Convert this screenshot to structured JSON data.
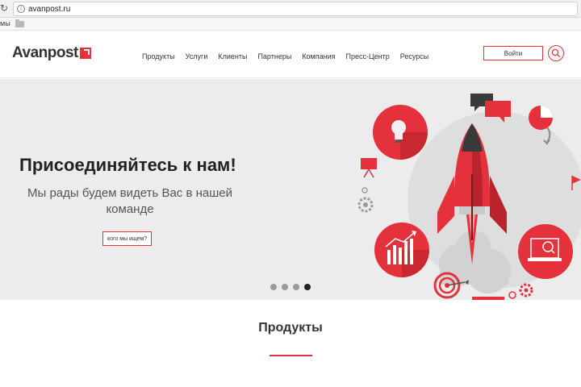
{
  "browser": {
    "url": "avanpost.ru",
    "bookmarks_label": "мы"
  },
  "header": {
    "logo_text": "Avanpost",
    "nav": [
      "Продукты",
      "Услуги",
      "Клиенты",
      "Партнеры",
      "Компания",
      "Пресс-Центр",
      "Ресурсы"
    ],
    "login_label": "Войти"
  },
  "hero": {
    "title": "Присоединяйтесь к нам!",
    "subtitle": "Мы рады будем видеть Вас в нашей команде",
    "cta_label": "кого мы ищем?",
    "slides_total": 4,
    "active_slide": 4
  },
  "products": {
    "title": "Продукты"
  },
  "icons": [
    "reload-icon",
    "info-icon",
    "folder-icon",
    "logo-mark-icon",
    "search-icon",
    "rocket-icon",
    "lightbulb-icon",
    "chat-bubbles-icon",
    "pie-chart-icon",
    "growth-chart-icon",
    "laptop-search-icon",
    "target-icon",
    "gear-icon",
    "flag-icon",
    "presentation-board-icon"
  ],
  "colors": {
    "accent": "#e4313b",
    "hero_background": "#ececec",
    "text": "#333333"
  }
}
